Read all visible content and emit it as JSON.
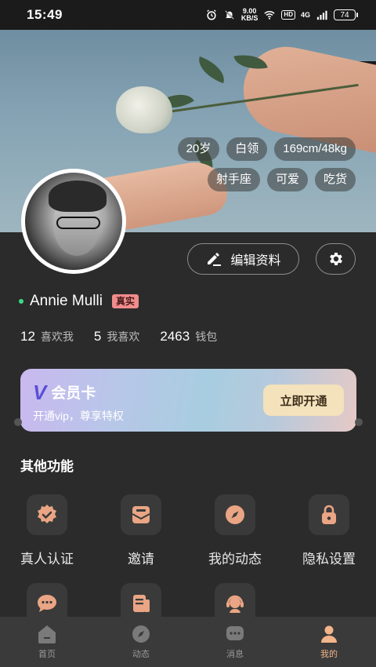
{
  "status_bar": {
    "time": "15:49",
    "net_speed_value": "9.00",
    "net_speed_unit": "KB/S",
    "hd": "HD",
    "network": "4G",
    "battery": "74"
  },
  "profile": {
    "tags_row1": [
      "20岁",
      "白领",
      "169cm/48kg"
    ],
    "tags_row2": [
      "射手座",
      "可爱",
      "吃货"
    ],
    "edit_label": "编辑资料",
    "name": "Annie Mulli",
    "verified_label": "真实",
    "stats": [
      {
        "num": "12",
        "label": "喜欢我"
      },
      {
        "num": "5",
        "label": "我喜欢"
      },
      {
        "num": "2463",
        "label": "钱包"
      }
    ]
  },
  "vip": {
    "logo": "V",
    "title": "会员卡",
    "subtitle": "开通vip，尊享特权",
    "button": "立即开通"
  },
  "other": {
    "title": "其他功能",
    "items": [
      {
        "label": "真人认证",
        "icon": "verify-badge-icon"
      },
      {
        "label": "邀请",
        "icon": "envelope-icon"
      },
      {
        "label": "我的动态",
        "icon": "compass-icon"
      },
      {
        "label": "隐私设置",
        "icon": "lock-icon"
      },
      {
        "label": "",
        "icon": "chat-bubble-icon"
      },
      {
        "label": "",
        "icon": "document-icon"
      },
      {
        "label": "",
        "icon": "customer-service-icon"
      }
    ]
  },
  "tabbar": {
    "items": [
      {
        "label": "首页",
        "icon": "home-icon"
      },
      {
        "label": "动态",
        "icon": "compass-icon"
      },
      {
        "label": "消息",
        "icon": "message-icon"
      },
      {
        "label": "我的",
        "icon": "person-icon"
      }
    ],
    "active_index": 3
  },
  "colors": {
    "background": "#2b2b2b",
    "accent": "#f1b58a",
    "icon_tint": "#e9a584",
    "vip_button": "#f3e2bb"
  }
}
